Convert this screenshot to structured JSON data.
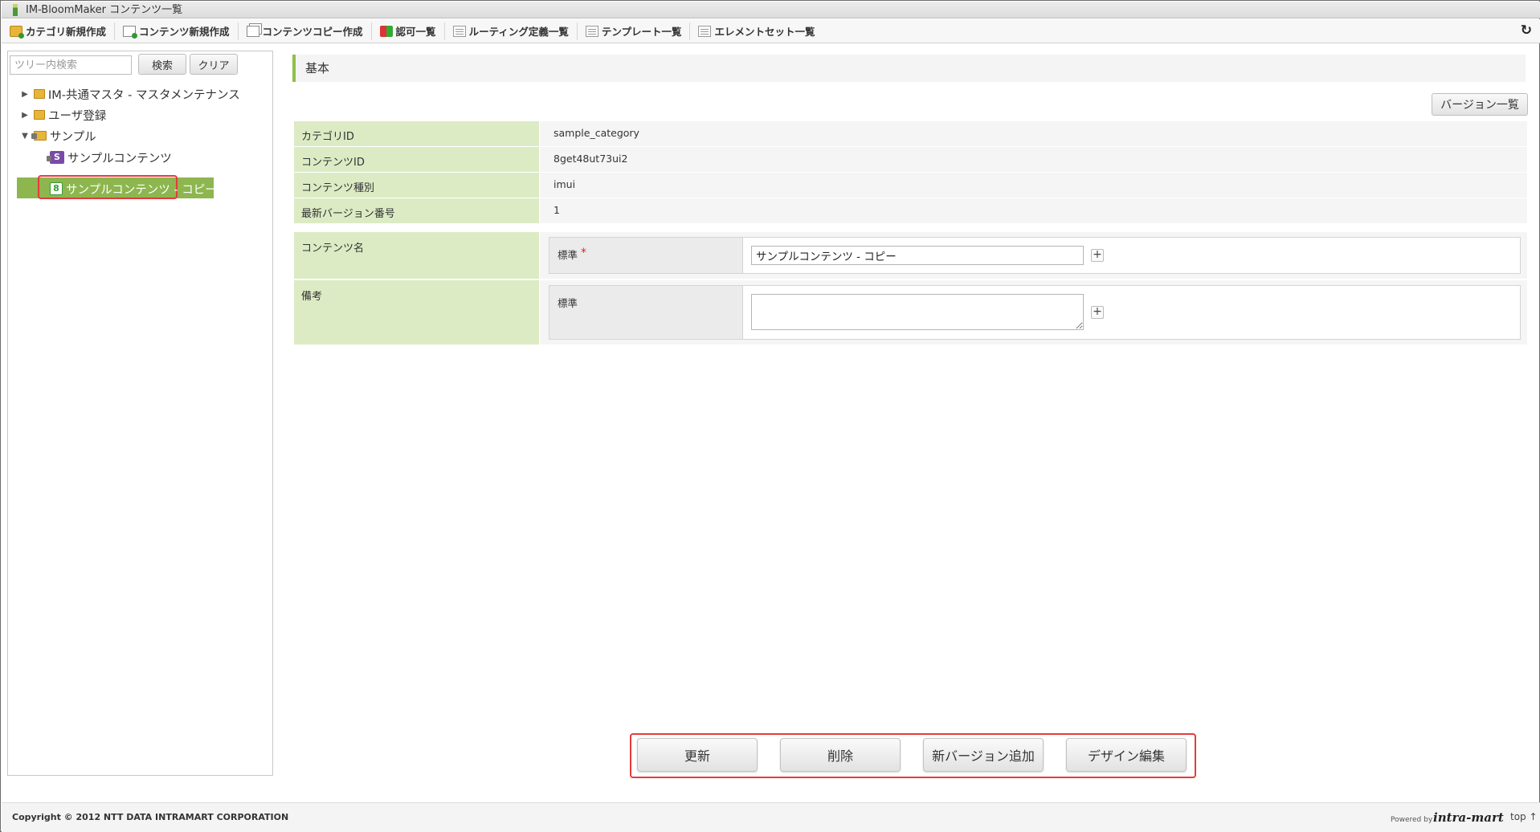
{
  "window": {
    "title": "IM-BloomMaker コンテンツ一覧"
  },
  "toolbar": {
    "items": [
      {
        "label": "カテゴリ新規作成",
        "icon": "folder-add-icon"
      },
      {
        "label": "コンテンツ新規作成",
        "icon": "document-add-icon"
      },
      {
        "label": "コンテンツコピー作成",
        "icon": "copy-icon"
      },
      {
        "label": "認可一覧",
        "icon": "authorization-icon"
      },
      {
        "label": "ルーティング定義一覧",
        "icon": "list-icon"
      },
      {
        "label": "テンプレート一覧",
        "icon": "list-icon"
      },
      {
        "label": "エレメントセット一覧",
        "icon": "list-icon"
      }
    ],
    "refresh_icon": "↻"
  },
  "sidebar": {
    "search_placeholder": "ツリー内検索",
    "search_button": "検索",
    "clear_button": "クリア",
    "tree": [
      {
        "label": "IM-共通マスタ - マスタメンテナンス",
        "type": "folder",
        "expanded": false
      },
      {
        "label": "ユーザ登録",
        "type": "folder",
        "expanded": false
      },
      {
        "label": "サンプル",
        "type": "locked-folder",
        "expanded": true
      },
      {
        "label": "サンプルコンテンツ",
        "type": "content-s",
        "badge": "S"
      },
      {
        "label": "サンプルコンテンツ - コピー",
        "type": "content-8",
        "badge": "8",
        "selected": true
      }
    ]
  },
  "main": {
    "section_title": "基本",
    "version_list_button": "バージョン一覧",
    "info": [
      {
        "label": "カテゴリID",
        "value": "sample_category"
      },
      {
        "label": "コンテンツID",
        "value": "8get48ut73ui2"
      },
      {
        "label": "コンテンツ種別",
        "value": "imui"
      },
      {
        "label": "最新バージョン番号",
        "value": "1"
      }
    ],
    "content_name": {
      "label": "コンテンツ名",
      "sub_label": "標準",
      "required_mark": "*",
      "value": "サンプルコンテンツ - コピー",
      "add_button": "+"
    },
    "remarks": {
      "label": "備考",
      "sub_label": "標準",
      "value": "",
      "add_button": "+"
    }
  },
  "actions": {
    "update": "更新",
    "delete": "削除",
    "add_version": "新バージョン追加",
    "design_edit": "デザイン編集"
  },
  "footer": {
    "copyright": "Copyright © 2012 NTT DATA INTRAMART CORPORATION",
    "powered_by": "Powered by",
    "logo_text": "intra-mart",
    "top_link": "top ↑"
  },
  "colors": {
    "accent_green": "#8db64f",
    "label_bg": "#dcebc4",
    "highlight_red": "#e53b3b"
  }
}
